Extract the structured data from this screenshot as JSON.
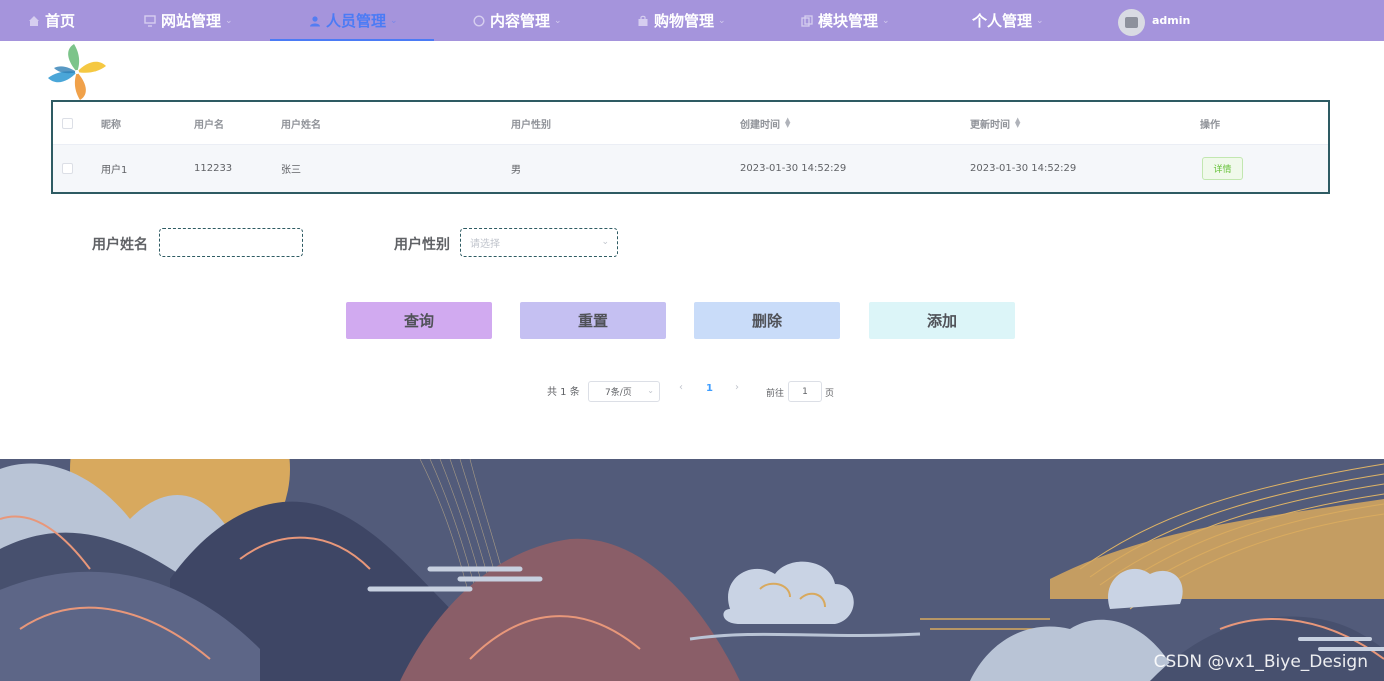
{
  "nav": {
    "items": [
      {
        "label": "首页",
        "icon": "home-icon"
      },
      {
        "label": "网站管理",
        "icon": "monitor-icon"
      },
      {
        "label": "人员管理",
        "icon": "user-icon"
      },
      {
        "label": "内容管理",
        "icon": "chat-icon"
      },
      {
        "label": "购物管理",
        "icon": "bag-icon"
      },
      {
        "label": "模块管理",
        "icon": "copy-icon"
      },
      {
        "label": "个人管理",
        "icon": ""
      }
    ],
    "active_index": 2,
    "user": "admin",
    "accent": "#4b7bf5",
    "bar_color": "#a594dc"
  },
  "table": {
    "headers": [
      "昵称",
      "用户名",
      "用户姓名",
      "用户性别",
      "创建时间",
      "更新时间",
      "操作"
    ],
    "rows": [
      {
        "nickname": "用户1",
        "username": "112233",
        "realname": "张三",
        "gender": "男",
        "created": "2023-01-30 14:52:29",
        "updated": "2023-01-30 14:52:29",
        "action": "详情"
      }
    ]
  },
  "search": {
    "name_label": "用户姓名",
    "name_value": "",
    "gender_label": "用户性别",
    "gender_placeholder": "请选择"
  },
  "buttons": {
    "query": "查询",
    "reset": "重置",
    "delete": "删除",
    "add": "添加"
  },
  "pagination": {
    "total": "共 1 条",
    "page_size": "7条/页",
    "current_page": "1",
    "goto_prefix": "前往",
    "goto_value": "1",
    "goto_suffix": "页"
  },
  "watermark": "CSDN @vx1_Biye_Design"
}
